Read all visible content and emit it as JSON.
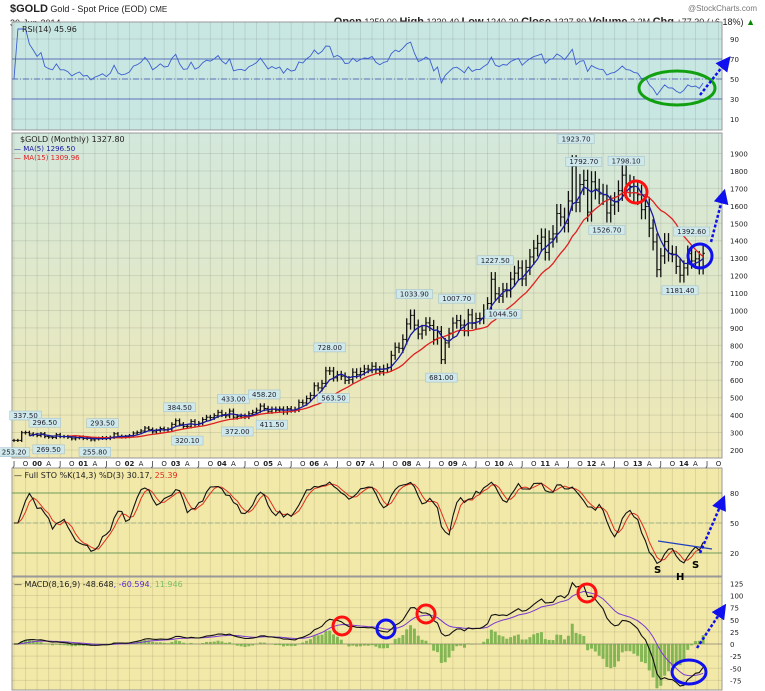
{
  "header": {
    "symbol": "$GOLD",
    "name": "Gold - Spot Price (EOD)",
    "exchange": "CME",
    "date": "30-Jun-2014",
    "copyright": "@StockCharts.com",
    "open_label": "Open",
    "open": "1250.00",
    "high_label": "High",
    "high": "1330.40",
    "low_label": "Low",
    "low": "1240.20",
    "close_label": "Close",
    "close": "1327.80",
    "volume_label": "Volume",
    "volume": "2.2M",
    "chg_label": "Chg",
    "chg": "+77.30 (+6.18%)"
  },
  "colors": {
    "ma5": "#1a1aa0",
    "ma15": "#e02020",
    "rsi": "#3a5fd0",
    "stoK": "#111111",
    "stoD": "#e03020",
    "macd": "#111111",
    "signal": "#7a3ad0",
    "hist": "#6aaa40",
    "annot_red": "#ff1010",
    "annot_blue": "#1010ee",
    "annot_green": "#10a010"
  },
  "chart_data": [
    {
      "type": "line",
      "title": "RSI(14) 45.96",
      "legend": "RSI(14) 45.96",
      "yticks": [
        "90",
        "70",
        "50",
        "30",
        "10"
      ],
      "ylim": [
        0,
        107
      ]
    },
    {
      "type": "bar",
      "subtype": "ohlc",
      "title": "$GOLD (Monthly) 1327.80",
      "legend": [
        {
          "name": "MA(5)",
          "value": "1296.50"
        },
        {
          "name": "MA(15)",
          "value": "1309.96"
        }
      ],
      "start": "1999-07",
      "frequency": "monthly",
      "close": [
        255,
        255,
        299,
        300,
        292,
        288,
        283,
        293,
        277,
        274,
        272,
        288,
        277,
        277,
        273,
        264,
        270,
        274,
        266,
        267,
        258,
        264,
        267,
        271,
        266,
        273,
        293,
        279,
        275,
        277,
        282,
        297,
        301,
        309,
        326,
        318,
        304,
        312,
        323,
        317,
        319,
        347,
        368,
        348,
        335,
        336,
        364,
        346,
        354,
        375,
        388,
        386,
        397,
        416,
        403,
        396,
        423,
        388,
        393,
        395,
        391,
        408,
        416,
        428,
        452,
        438,
        422,
        434,
        428,
        435,
        417,
        437,
        429,
        433,
        473,
        470,
        495,
        513,
        568,
        556,
        582,
        654,
        653,
        614,
        632,
        623,
        599,
        603,
        646,
        632,
        650,
        665,
        663,
        680,
        659,
        650,
        666,
        673,
        743,
        789,
        783,
        834,
        923,
        972,
        916,
        865,
        887,
        929,
        914,
        833,
        880,
        718,
        814,
        870,
        928,
        942,
        916,
        883,
        975,
        926,
        954,
        955,
        1001,
        1040,
        1179,
        1096,
        1081,
        1119,
        1113,
        1180,
        1214,
        1244,
        1181,
        1247,
        1307,
        1357,
        1385,
        1421,
        1333,
        1410,
        1439,
        1556,
        1536,
        1500,
        1628,
        1827,
        1620,
        1722,
        1746,
        1564,
        1738,
        1696,
        1668,
        1663,
        1559,
        1604,
        1622,
        1687,
        1776,
        1719,
        1711,
        1675,
        1663,
        1578,
        1596,
        1472,
        1393,
        1234,
        1313,
        1395,
        1327,
        1323,
        1253,
        1202,
        1244,
        1326,
        1284,
        1296,
        1250,
        1327.8
      ],
      "annotations": [
        {
          "text": "253.20",
          "date": "1999-07",
          "price": 253.2,
          "pos": "below"
        },
        {
          "text": "337.50",
          "date": "1999-10",
          "price": 337.5,
          "pos": "above"
        },
        {
          "text": "296.50",
          "date": "2000-03",
          "price": 296.5,
          "pos": "above"
        },
        {
          "text": "269.50",
          "date": "2000-04",
          "price": 269.5,
          "pos": "below"
        },
        {
          "text": "293.50",
          "date": "2001-06",
          "price": 293.5,
          "pos": "above"
        },
        {
          "text": "255.80",
          "date": "2001-04",
          "price": 255.8,
          "pos": "below"
        },
        {
          "text": "384.50",
          "date": "2003-02",
          "price": 384.5,
          "pos": "above"
        },
        {
          "text": "320.10",
          "date": "2003-04",
          "price": 320.1,
          "pos": "below"
        },
        {
          "text": "433.00",
          "date": "2004-04",
          "price": 433.0,
          "pos": "above"
        },
        {
          "text": "372.00",
          "date": "2004-05",
          "price": 372.0,
          "pos": "below"
        },
        {
          "text": "458.20",
          "date": "2004-12",
          "price": 458.2,
          "pos": "above"
        },
        {
          "text": "411.50",
          "date": "2005-02",
          "price": 411.5,
          "pos": "below"
        },
        {
          "text": "728.00",
          "date": "2006-05",
          "price": 728.0,
          "pos": "above"
        },
        {
          "text": "563.50",
          "date": "2006-06",
          "price": 563.5,
          "pos": "below"
        },
        {
          "text": "1033.90",
          "date": "2008-03",
          "price": 1033.9,
          "pos": "above"
        },
        {
          "text": "681.00",
          "date": "2008-10",
          "price": 681.0,
          "pos": "below"
        },
        {
          "text": "1007.70",
          "date": "2009-02",
          "price": 1007.7,
          "pos": "above"
        },
        {
          "text": "1227.50",
          "date": "2009-12",
          "price": 1227.5,
          "pos": "above"
        },
        {
          "text": "1044.50",
          "date": "2010-02",
          "price": 1044.5,
          "pos": "below"
        },
        {
          "text": "1923.70",
          "date": "2011-09",
          "price": 1923.7,
          "pos": "above"
        },
        {
          "text": "1792.70",
          "date": "2011-11",
          "price": 1792.7,
          "pos": "above"
        },
        {
          "text": "1526.70",
          "date": "2012-05",
          "price": 1526.7,
          "pos": "below"
        },
        {
          "text": "1798.10",
          "date": "2012-10",
          "price": 1798.1,
          "pos": "above"
        },
        {
          "text": "1181.40",
          "date": "2013-12",
          "price": 1181.4,
          "pos": "below"
        },
        {
          "text": "1392.60",
          "date": "2014-03",
          "price": 1392.6,
          "pos": "above"
        }
      ],
      "yticks": [
        "1900",
        "1800",
        "1700",
        "1600",
        "1500",
        "1400",
        "1300",
        "1200",
        "1100",
        "1000",
        "900",
        "800",
        "700",
        "600",
        "500",
        "400",
        "300",
        "200"
      ],
      "ylim": [
        200,
        1950
      ]
    },
    {
      "type": "line",
      "title": "Full STO %K(14,3) %D(3)",
      "legend": [
        {
          "name": "Full STO %K(14,3) %D(3)",
          "value": "30.17"
        },
        {
          "name": "%D",
          "value": "25.39"
        }
      ],
      "yticks": [
        "80",
        "50",
        "20"
      ],
      "ylim": [
        0,
        105
      ],
      "labels": [
        "S",
        "H",
        "S"
      ]
    },
    {
      "type": "line",
      "title": "MACD(8,16,9)",
      "legend": [
        {
          "name": "MACD(8,16,9)",
          "value": "-48.648"
        },
        {
          "name": "signal",
          "value": ", -60.594"
        },
        {
          "name": "histogram",
          "value": ", 11.946"
        }
      ],
      "yticks": [
        "125",
        "100",
        "75",
        "50",
        "25",
        "0",
        "-25",
        "-50",
        "-75"
      ],
      "ylim": [
        -95,
        135
      ]
    }
  ],
  "x_axis_labels": [
    "J",
    "O",
    "00",
    "A",
    "J",
    "O",
    "01",
    "A",
    "J",
    "O",
    "02",
    "A",
    "J",
    "O",
    "03",
    "A",
    "J",
    "O",
    "04",
    "A",
    "J",
    "O",
    "05",
    "A",
    "J",
    "O",
    "06",
    "A",
    "J",
    "O",
    "07",
    "A",
    "J",
    "O",
    "08",
    "A",
    "J",
    "O",
    "09",
    "A",
    "J",
    "O",
    "10",
    "A",
    "J",
    "O",
    "11",
    "A",
    "J",
    "O",
    "12",
    "A",
    "J",
    "O",
    "13",
    "A",
    "J",
    "O",
    "14",
    "A",
    "J",
    "O"
  ]
}
